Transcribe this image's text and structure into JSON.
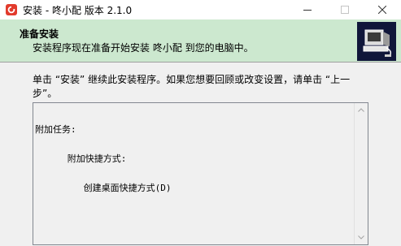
{
  "window": {
    "title": "安装 - 咚小配 版本 2.1.0",
    "controls": {
      "minimize_icon": "minimize-icon",
      "maximize_icon": "maximize-icon",
      "close_icon": "close-icon"
    }
  },
  "header": {
    "title": "准备安装",
    "subtitle": "安装程序现在准备开始安装 咚小配 到您的电脑中。",
    "image_icon": "installer-computer-icon"
  },
  "body": {
    "instruction": "单击 “安装” 继续此安装程序。如果您想要回顾或改变设置，请单击 “上一步”。"
  },
  "memo": {
    "lines": [
      "附加任务:",
      "      附加快捷方式:",
      "         创建桌面快捷方式(D)"
    ]
  },
  "colors": {
    "header_bg": "#cce8cf",
    "window_bg": "#f0f0f0",
    "app_icon": "#e23b2d"
  }
}
